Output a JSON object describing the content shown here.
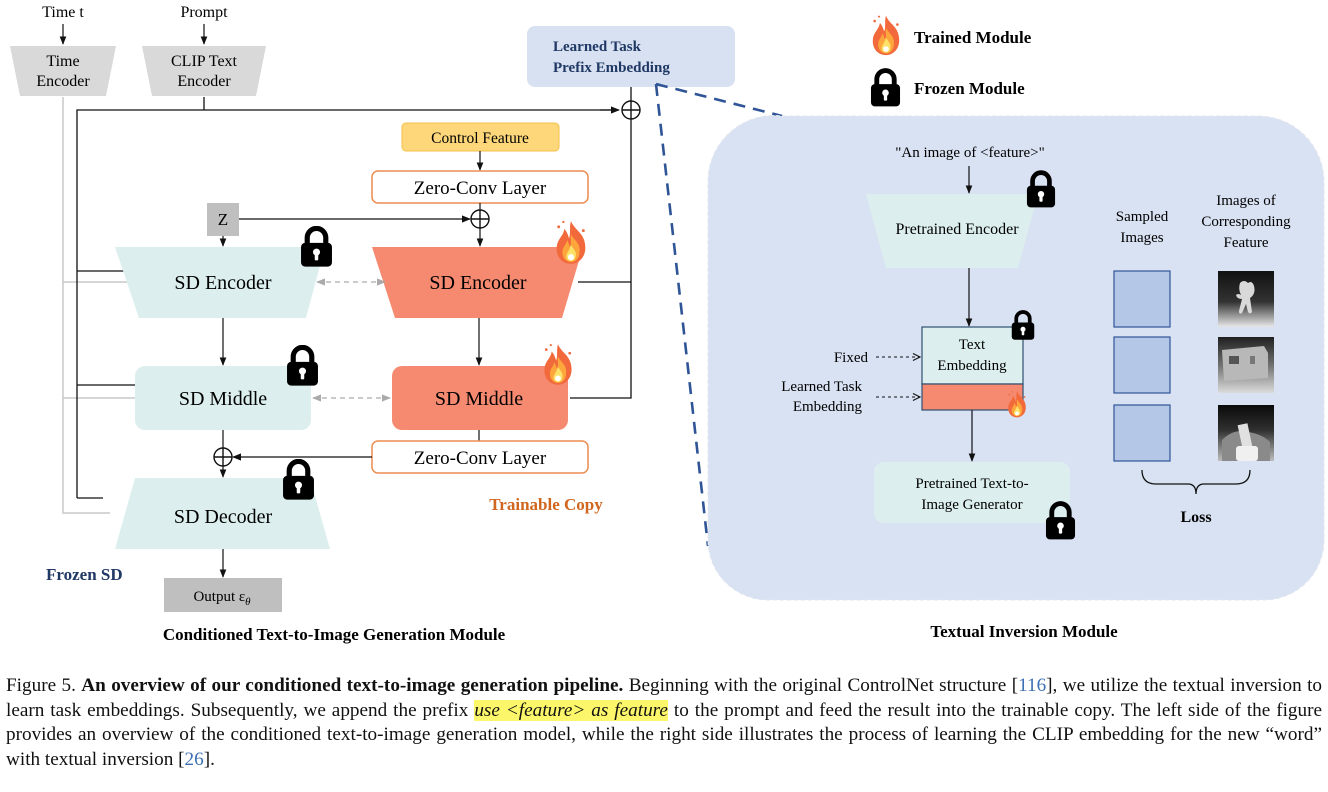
{
  "inputs": {
    "time": "Time t",
    "prompt": "Prompt"
  },
  "encoders": {
    "time_line1": "Time",
    "time_line2": "Encoder",
    "clip_line1": "CLIP Text",
    "clip_line2": "Encoder"
  },
  "prefix_box": {
    "line1": "Learned Task",
    "line2": "Prefix Embedding"
  },
  "legend": {
    "trained": "Trained Module",
    "frozen": "Frozen Module"
  },
  "left": {
    "control_feature": "Control Feature",
    "zero_conv_top": "Zero-Conv Layer",
    "zero_conv_bottom": "Zero-Conv Layer",
    "z_label": "Z",
    "frozen_encoder": "SD Encoder",
    "frozen_middle": "SD Middle",
    "frozen_decoder": "SD Decoder",
    "trainable_encoder": "SD Encoder",
    "trainable_middle": "SD Middle",
    "trainable_copy_label": "Trainable Copy",
    "frozen_sd_label": "Frozen SD",
    "output_label": "Output ε",
    "output_sub": "θ",
    "module_title": "Conditioned Text-to-Image Generation Module"
  },
  "right": {
    "prompt_text": "\"An image of <feature>\"",
    "pretrained_encoder": "Pretrained Encoder",
    "text_embedding_line1": "Text",
    "text_embedding_line2": "Embedding",
    "fixed_label": "Fixed",
    "learned_line1": "Learned Task",
    "learned_line2": "Embedding",
    "generator_line1": "Pretrained Text-to-",
    "generator_line2": "Image Generator",
    "sampled_line1": "Sampled",
    "sampled_line2": "Images",
    "feature_line1": "Images of",
    "feature_line2": "Corresponding",
    "feature_line3": "Feature",
    "loss_label": "Loss",
    "module_title": "Textual Inversion Module"
  },
  "colors": {
    "frozen_fill": "#dcefee",
    "trainable_fill": "#f58a71",
    "encoder_gray": "#d9d9d9",
    "control_feature": "#fdd77a",
    "zero_conv_border": "#ec8c50",
    "prefix_box": "#d7e1f2",
    "inversion_panel": "#d9e2f3",
    "dashed_blue": "#2f5597",
    "trainable_text": "#d0661f",
    "frozen_text": "#203864",
    "sampled_box": "#b4c7e7"
  },
  "caption": {
    "figure_label": "Figure 5.",
    "bold_title": "An overview of our conditioned text-to-image generation pipeline.",
    "text_part1": "Beginning with the original ControlNet structure [",
    "ref1": "116",
    "text_part2": "], we utilize the textual inversion to learn task embeddings. Subsequently, we append the prefix",
    "highlight": "use <feature> as feature",
    "text_part3": "to the prompt and feed the result into the trainable copy. The left side of the figure provides an overview of the conditioned text-to-image generation model, while the right side illustrates the process of learning the CLIP embedding for the new “word” with textual inversion [",
    "ref2": "26",
    "text_part4": "]."
  }
}
